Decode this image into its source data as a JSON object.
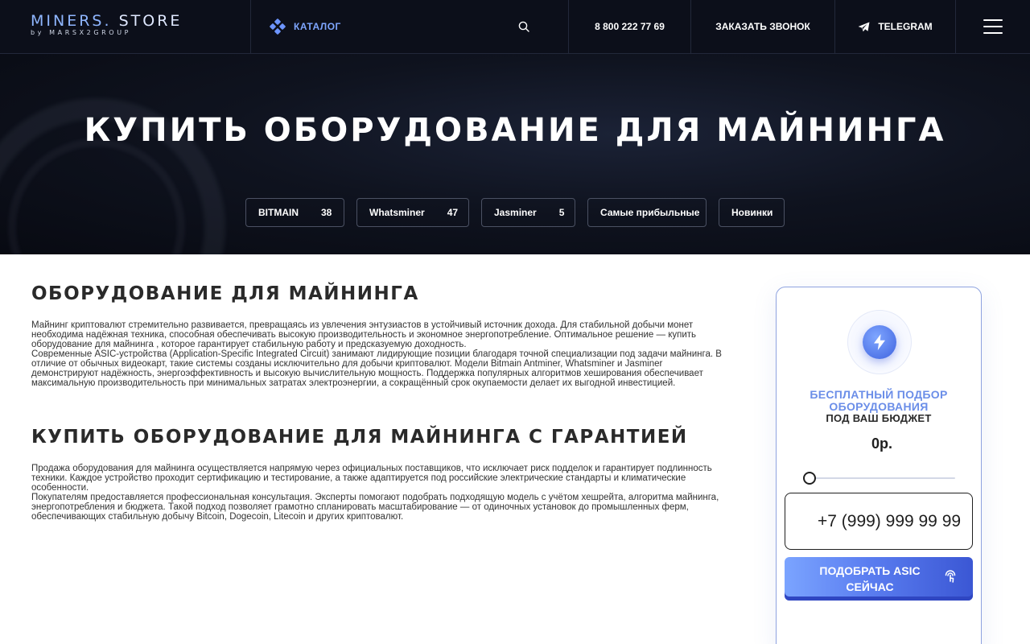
{
  "header": {
    "logo_main_a": "MINERS.",
    "logo_main_b": "STORE",
    "logo_sub": "by MARSX2GROUP",
    "catalog_label": "КАТАЛОГ",
    "phone": "8 800 222 77 69",
    "callback_label": "ЗАКАЗАТЬ ЗВОНОК",
    "telegram_label": "TELEGRAM"
  },
  "hero": {
    "title": "КУПИТЬ ОБОРУДОВАНИЕ ДЛЯ МАЙНИНГА",
    "chips": [
      {
        "label": "BITMAIN",
        "count": "38"
      },
      {
        "label": "Whatsminer",
        "count": "47"
      },
      {
        "label": "Jasminer",
        "count": "5"
      },
      {
        "label": "Самые прибыльные"
      },
      {
        "label": "Новинки"
      }
    ]
  },
  "content": {
    "section1_title": "ОБОРУДОВАНИЕ ДЛЯ МАЙНИНГА",
    "section1_p1": "Майнинг криптовалют стремительно развивается, превращаясь из увлечения энтузиастов в устойчивый источник дохода. Для стабильной добычи монет необходима надёжная техника, способная обеспечивать высокую производительность и экономное энергопотребление. Оптимальное решение — купить оборудование для майнинга , которое гарантирует стабильную работу и предсказуемую доходность.",
    "section1_p2": "Современные ASIC-устройства (Application-Specific Integrated Circuit) занимают лидирующие позиции благодаря точной специализации под задачи майнинга. В отличие от обычных видеокарт, такие системы созданы исключительно для добычи криптовалют. Модели Bitmain Antminer, Whatsminer и Jasminer демонстрируют надёжность, энергоэффективность и высокую вычислительную мощность. Поддержка популярных алгоритмов хеширования обеспечивает максимальную производительность при минимальных затратах электроэнергии, а сокращённый срок окупаемости делает их выгодной инвестицией.",
    "section2_title": "КУПИТЬ ОБОРУДОВАНИЕ ДЛЯ МАЙНИНГА С ГАРАНТИЕЙ",
    "section2_p1": "Продажа оборудования для майнинга осуществляется напрямую через официальных поставщиков, что исключает риск подделок и гарантирует подлинность техники. Каждое устройство проходит сертификацию и тестирование, а также адаптируется под российские электрические стандарты и климатические особенности.",
    "section2_p2": "Покупателям предоставляется профессиональная консультация. Эксперты помогают подобрать подходящую модель с учётом хешрейта, алгоритма майнинга, энергопотребления и бюджета. Такой подход позволяет грамотно спланировать масштабирование — от одиночных установок до промышленных ферм, обеспечивающих стабильную добычу Bitcoin, Dogecoin, Litecoin и других криптовалют."
  },
  "card": {
    "title_line1": "БЕСПЛАТНЫЙ ПОДБОР",
    "title_line2": "ОБОРУДОВАНИЯ",
    "subtitle": "ПОД ВАШ БЮДЖЕТ",
    "price": "0р.",
    "budget_value": 0,
    "phone_placeholder": "+7 (999) 999 99 99",
    "cta_line1": "ПОДОБРАТЬ ASIC",
    "cta_line2": "СЕЙЧАС"
  },
  "icons": {
    "catalog": "diamond-grid-icon",
    "search": "search-icon",
    "telegram": "paper-plane-icon",
    "menu": "burger-icon",
    "bolt": "lightning-icon",
    "cta": "tap-icon"
  },
  "colors": {
    "header_bg": "#0c0f1a",
    "accent": "#6b8ee8",
    "catalog_blue": "#7ea6ff",
    "cta_gradient_start": "#7ba4ff",
    "cta_gradient_end": "#3b57d4"
  }
}
